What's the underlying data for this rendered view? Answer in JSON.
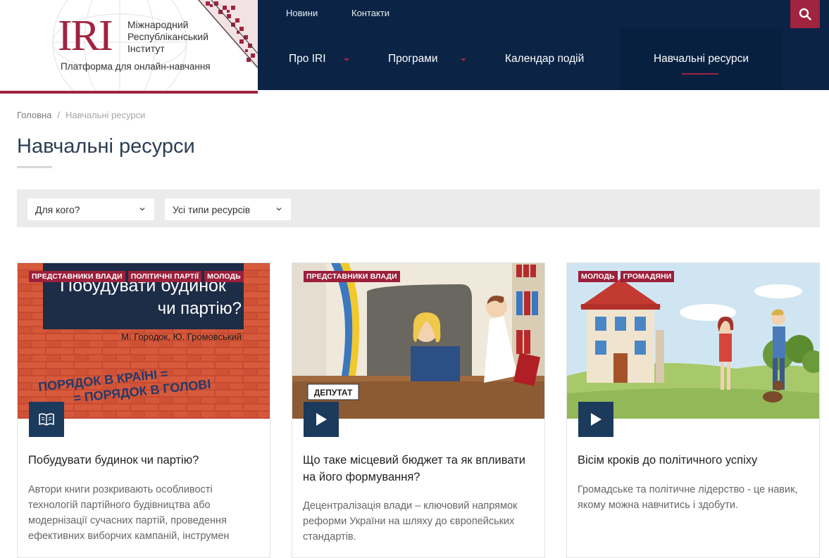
{
  "logo": {
    "mark": "IRI",
    "line1": "Міжнародний",
    "line2": "Республіканський",
    "line3": "Інститут",
    "tagline": "Платформа для онлайн-навчання"
  },
  "topbar": {
    "links": [
      "Новини",
      "Контакти"
    ],
    "search_icon": "search-icon"
  },
  "nav": {
    "items": [
      {
        "label": "Про IRI",
        "has_dropdown": true
      },
      {
        "label": "Програми",
        "has_dropdown": true
      },
      {
        "label": "Календар подій",
        "has_dropdown": false
      },
      {
        "label": "Навчальні ресурси",
        "active": true
      }
    ]
  },
  "breadcrumb": {
    "home": "Головна",
    "separator": "/",
    "current": "Навчальні ресурси"
  },
  "page": {
    "title": "Навчальні ресурси"
  },
  "filters": {
    "audience": "Для кого?",
    "type": "Усі типи ресурсів"
  },
  "cards": [
    {
      "tags": [
        "ПРЕДСТАВНИКИ ВЛАДИ",
        "ПОЛІТИЧНІ ПАРТІЇ",
        "МОЛОДЬ"
      ],
      "media_icon": "book-icon",
      "title": "Побудувати будинок чи партію?",
      "text": "Автори книги розкривають особливості технологій партійного будівництва або модернізації сучасних партій, проведення ефективних виборчих кампаній, інструмен",
      "image_text": {
        "cover_title_top": "Побудувати будинок",
        "cover_title_bottom": "чи партію?",
        "authors": "М. Городок, Ю. Громовський",
        "slogan1": "ПОРЯДОК В КРАЇНІ =",
        "slogan2": "= ПОРЯДОК В ГОЛОВІ"
      }
    },
    {
      "tags": [
        "ПРЕДСТАВНИКИ ВЛАДИ"
      ],
      "media_icon": "play-icon",
      "title": "Що таке місцевий бюджет та як впливати на його формування?",
      "text": "Децентралізація влади – ключовий напрямок реформи України на шляху до європейських стандартів.",
      "image_text": {
        "plate": "ДЕПУТАТ"
      }
    },
    {
      "tags": [
        "МОЛОДЬ",
        "ГРОМАДЯНИ"
      ],
      "media_icon": "play-icon",
      "title": "Вісім кроків до політичного успіху",
      "text": "Громадське та політичне лідерство - це навик, якому можна навчитись і здобути."
    }
  ],
  "colors": {
    "brand_red": "#a0233f",
    "nav_blue": "#0b2446",
    "button_blue": "#1c3a5c"
  }
}
